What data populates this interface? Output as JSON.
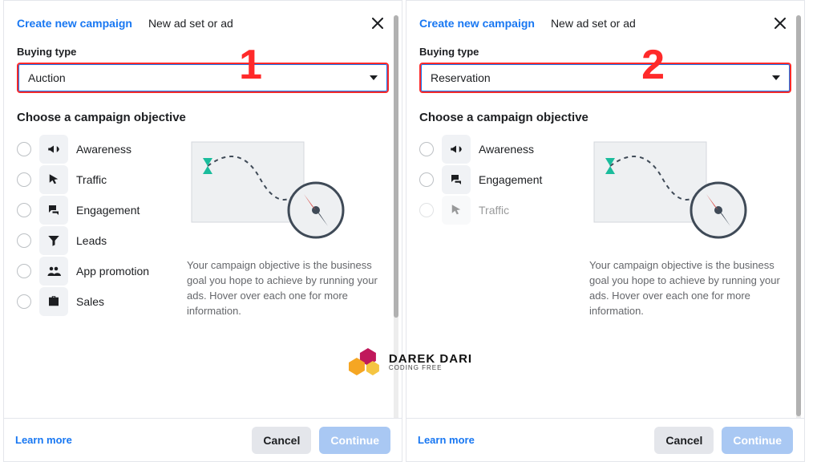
{
  "common": {
    "tab_primary": "Create new campaign",
    "tab_secondary": "New ad set or ad",
    "buying_type_label": "Buying type",
    "subheader": "Choose a campaign objective",
    "side_text": "Your campaign objective is the business goal you hope to achieve by running your ads. Hover over each one for more information.",
    "learn_more": "Learn more",
    "cancel": "Cancel",
    "continue": "Continue"
  },
  "panel_1": {
    "marker": "1",
    "buying_value": "Auction",
    "options": {
      "awareness": "Awareness",
      "traffic": "Traffic",
      "engagement": "Engagement",
      "leads": "Leads",
      "app_promotion": "App promotion",
      "sales": "Sales"
    }
  },
  "panel_2": {
    "marker": "2",
    "buying_value": "Reservation",
    "options": {
      "awareness": "Awareness",
      "engagement": "Engagement",
      "traffic": "Traffic"
    }
  },
  "brand": {
    "title": "DAREK DARI",
    "sub": "CODING FREE"
  }
}
